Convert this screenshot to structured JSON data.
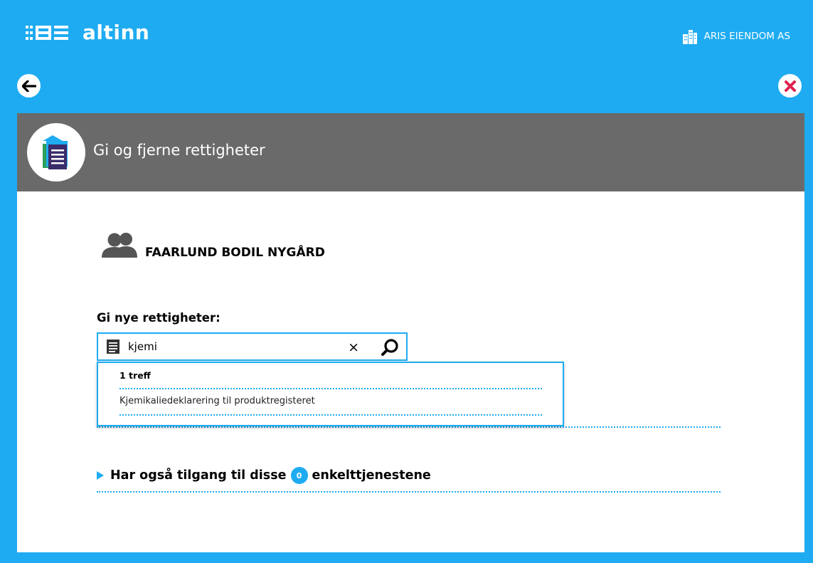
{
  "app": {
    "logo_text": "altinn",
    "organization": "ARIS EIENDOM AS"
  },
  "nav": {
    "back_icon": "arrow-left-icon",
    "close_icon": "close-icon"
  },
  "modal": {
    "title": "Gi og fjerne rettigheter",
    "header_icon": "documents-icon",
    "person_name": "FAARLUND BODIL NYGÅRD",
    "section_label": "Gi nye rettigheter:",
    "search": {
      "value": "kjemi",
      "placeholder": ""
    },
    "dropdown": {
      "count_text": "1 treff",
      "results": [
        "Kjemikaliedeklarering til produktregisteret"
      ]
    },
    "expand": {
      "text_before": "Har også tilgang til disse",
      "count": "0",
      "text_after": "enkelttjenestene"
    }
  },
  "colors": {
    "brand_blue": "#1eabf1",
    "header_gray": "#6a6a6a",
    "close_red": "#e0224e"
  }
}
